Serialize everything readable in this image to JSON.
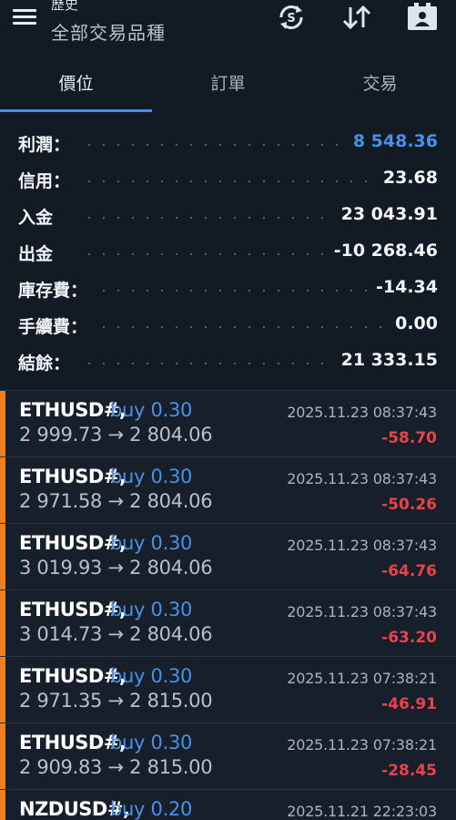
{
  "header": {
    "title": "歷史",
    "subtitle": "全部交易品種",
    "icons": [
      "menu-icon",
      "currency-refresh-icon",
      "sort-icon",
      "profile-card-icon"
    ]
  },
  "tabs": [
    {
      "label": "價位",
      "active": true
    },
    {
      "label": "訂單",
      "active": false
    },
    {
      "label": "交易",
      "active": false
    }
  ],
  "summary": [
    {
      "label": "利潤：",
      "value": "8 548.36",
      "highlight": true
    },
    {
      "label": "信用：",
      "value": "23.68"
    },
    {
      "label": "入金",
      "value": "23 043.91"
    },
    {
      "label": "出金",
      "value": "-10 268.46"
    },
    {
      "label": "庫存費：",
      "value": "-14.34"
    },
    {
      "label": "手續費：",
      "value": "0.00"
    },
    {
      "label": "結餘：",
      "value": "21 333.15"
    }
  ],
  "trades": [
    {
      "symbol": "ETHUSD#,",
      "side": "buy 0.30",
      "prices": "2 999.73 → 2 804.06",
      "time": "2025.11.23 08:37:43",
      "pl": "-58.70"
    },
    {
      "symbol": "ETHUSD#,",
      "side": "buy 0.30",
      "prices": "2 971.58 → 2 804.06",
      "time": "2025.11.23 08:37:43",
      "pl": "-50.26"
    },
    {
      "symbol": "ETHUSD#,",
      "side": "buy 0.30",
      "prices": "3 019.93 → 2 804.06",
      "time": "2025.11.23 08:37:43",
      "pl": "-64.76"
    },
    {
      "symbol": "ETHUSD#,",
      "side": "buy 0.30",
      "prices": "3 014.73 → 2 804.06",
      "time": "2025.11.23 08:37:43",
      "pl": "-63.20"
    },
    {
      "symbol": "ETHUSD#,",
      "side": "buy 0.30",
      "prices": "2 971.35 → 2 815.00",
      "time": "2025.11.23 07:38:21",
      "pl": "-46.91"
    },
    {
      "symbol": "ETHUSD#,",
      "side": "buy 0.30",
      "prices": "2 909.83 → 2 815.00",
      "time": "2025.11.23 07:38:21",
      "pl": "-28.45"
    },
    {
      "symbol": "NZDUSD#,",
      "side": "buy 0.20",
      "prices": "",
      "time": "2025.11.21 22:23:03",
      "pl": ""
    }
  ],
  "colors": {
    "background": "#121a24",
    "accent_blue": "#4a90e8",
    "loss_red": "#e8424a",
    "buy_marker_orange": "#f07e1c"
  }
}
